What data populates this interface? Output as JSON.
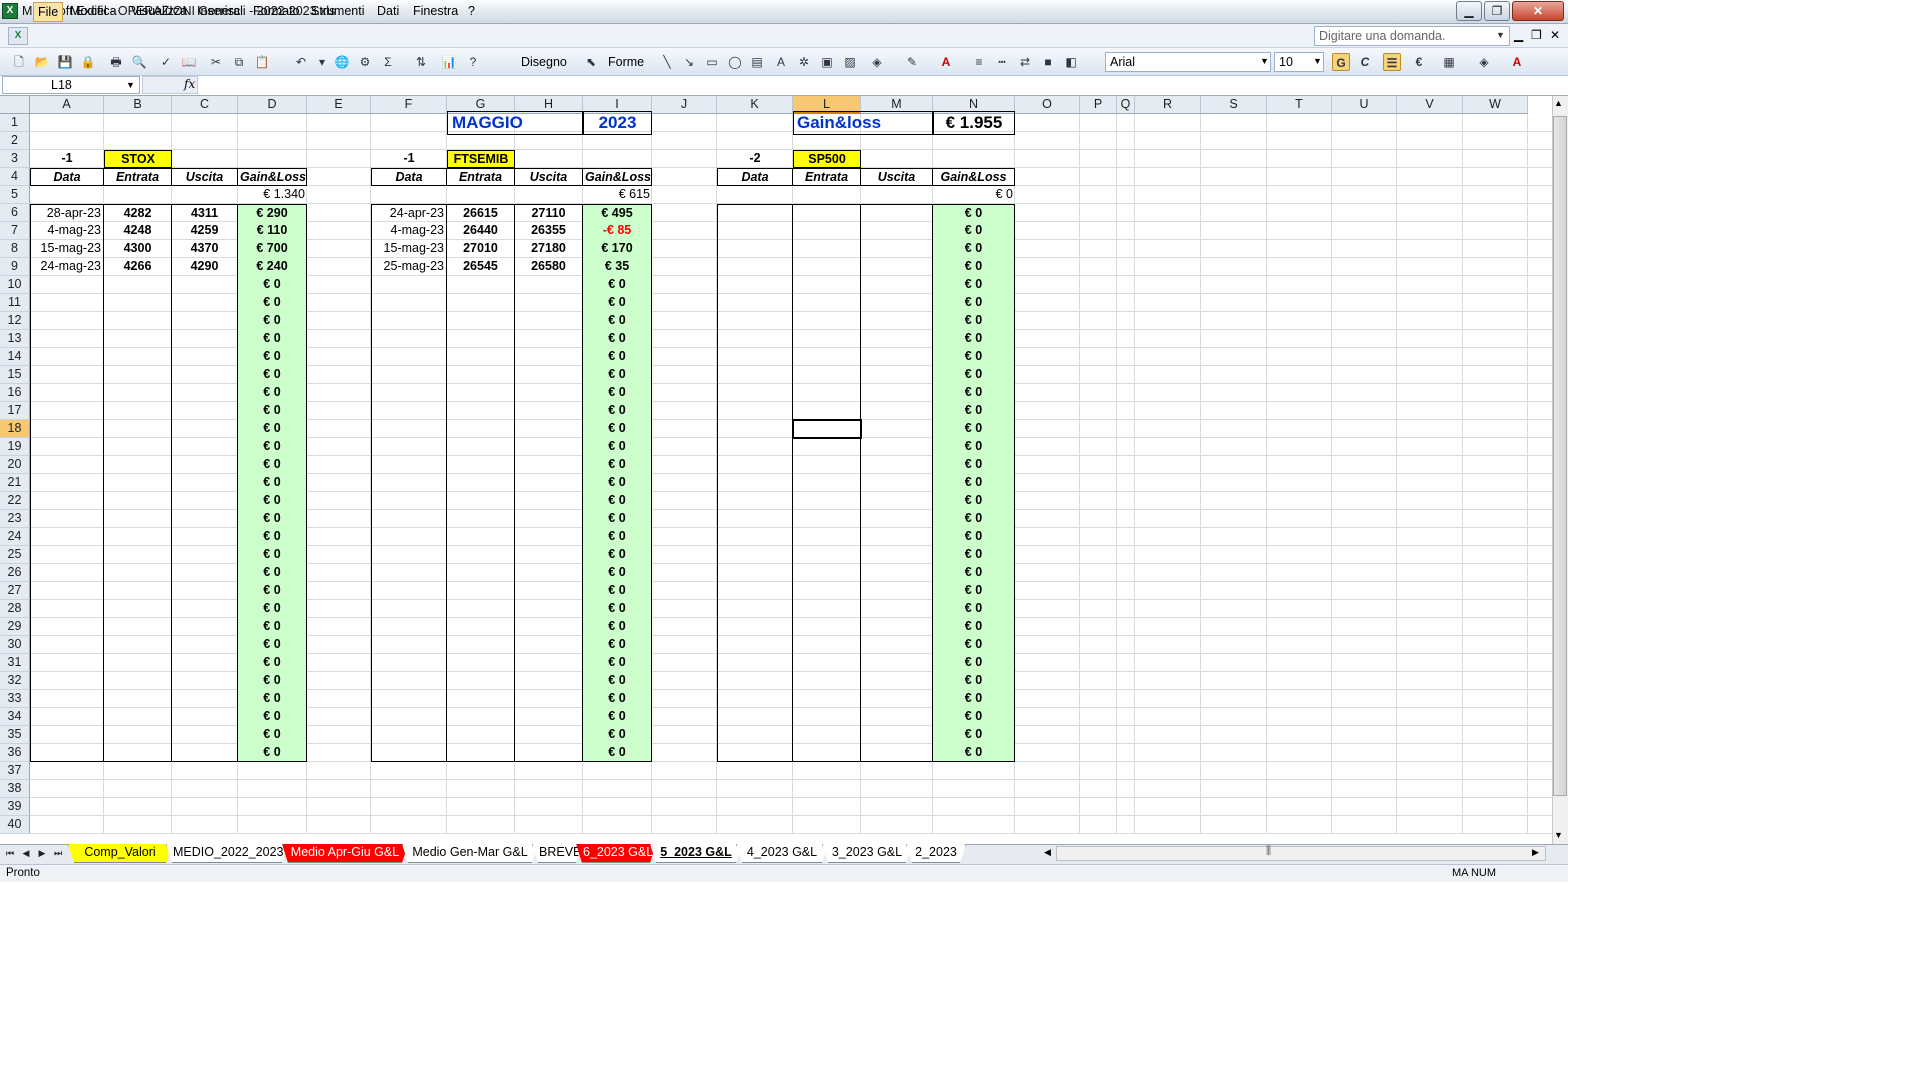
{
  "window": {
    "title": "Microsoft Excel - OPERAZIONI Generali - 2022-2023.xls",
    "minimize": "▁",
    "restore": "❐",
    "close": "✕"
  },
  "menu": {
    "items": [
      "File",
      "Modifica",
      "Visualizza",
      "Inserisci",
      "Formato",
      "Strumenti",
      "Dati",
      "Finestra",
      "?"
    ],
    "ask_placeholder": "Digitare una domanda.",
    "doc_controls": [
      "▁",
      "❐",
      "✕"
    ]
  },
  "toolbar": {
    "drawing_label": "Disegno",
    "shapes_label": "Forme",
    "font": "Arial",
    "font_size": "10",
    "bold": "G",
    "italic": "C",
    "currency": "€"
  },
  "formula_bar": {
    "cell_ref": "L18",
    "fx": "fx",
    "content": ""
  },
  "grid": {
    "columns": [
      "A",
      "B",
      "C",
      "D",
      "E",
      "F",
      "G",
      "H",
      "I",
      "J",
      "K",
      "L",
      "M",
      "N",
      "O",
      "P",
      "Q",
      "R",
      "S",
      "T",
      "U",
      "V",
      "W"
    ],
    "selected_column": "L",
    "selected_row": 18,
    "rows_visible": 40
  },
  "sheet": {
    "header": {
      "month": "MAGGIO",
      "year": "2023",
      "gl_label": "Gain&loss",
      "gl_total": "€ 1.955"
    },
    "col_headers": [
      "Data",
      "Entrata",
      "Uscita",
      "Gain&Loss"
    ],
    "blocks": [
      {
        "multiplier": "-1",
        "ticker": "STOX",
        "total": "€ 1.340",
        "rows": [
          {
            "date": "28-apr-23",
            "entry": "4282",
            "exit": "4311",
            "gl": "€ 290"
          },
          {
            "date": "4-mag-23",
            "entry": "4248",
            "exit": "4259",
            "gl": "€ 110"
          },
          {
            "date": "15-mag-23",
            "entry": "4300",
            "exit": "4370",
            "gl": "€ 700"
          },
          {
            "date": "24-mag-23",
            "entry": "4266",
            "exit": "4290",
            "gl": "€ 240"
          }
        ]
      },
      {
        "multiplier": "-1",
        "ticker": "FTSEMIB",
        "total": "€ 615",
        "rows": [
          {
            "date": "24-apr-23",
            "entry": "26615",
            "exit": "27110",
            "gl": "€ 495"
          },
          {
            "date": "4-mag-23",
            "entry": "26440",
            "exit": "26355",
            "gl": "-€ 85",
            "negative": true
          },
          {
            "date": "15-mag-23",
            "entry": "27010",
            "exit": "27180",
            "gl": "€ 170"
          },
          {
            "date": "25-mag-23",
            "entry": "26545",
            "exit": "26580",
            "gl": "€ 35"
          }
        ]
      },
      {
        "multiplier": "-2",
        "ticker": "SP500",
        "total": "€ 0",
        "rows": []
      }
    ],
    "zero_value": "€ 0"
  },
  "tabs": [
    {
      "label": "Comp_Valori",
      "color": "#ffff00",
      "text_color": "#000000"
    },
    {
      "label": "MEDIO_2022_2023",
      "color": "#ffffff",
      "text_color": "#000000"
    },
    {
      "label": "Medio Apr-Giu G&L",
      "color": "#ff0000",
      "text_color": "#ffffff"
    },
    {
      "label": "Medio Gen-Mar G&L",
      "color": "#ffffff",
      "text_color": "#000000"
    },
    {
      "label": "BREVE",
      "color": "#ffffff",
      "text_color": "#000000"
    },
    {
      "label": "6_2023 G&L",
      "color": "#ff0000",
      "text_color": "#ffffff"
    },
    {
      "label": "5_2023 G&L",
      "color": "#ffffff",
      "text_color": "#000000",
      "active": true
    },
    {
      "label": "4_2023 G&L",
      "color": "#ffffff",
      "text_color": "#000000"
    },
    {
      "label": "3_2023 G&L",
      "color": "#ffffff",
      "text_color": "#000000"
    },
    {
      "label": "2_2023",
      "color": "#ffffff",
      "text_color": "#000000"
    }
  ],
  "status": {
    "text": "Pronto",
    "indicators": "MA  NUM"
  }
}
